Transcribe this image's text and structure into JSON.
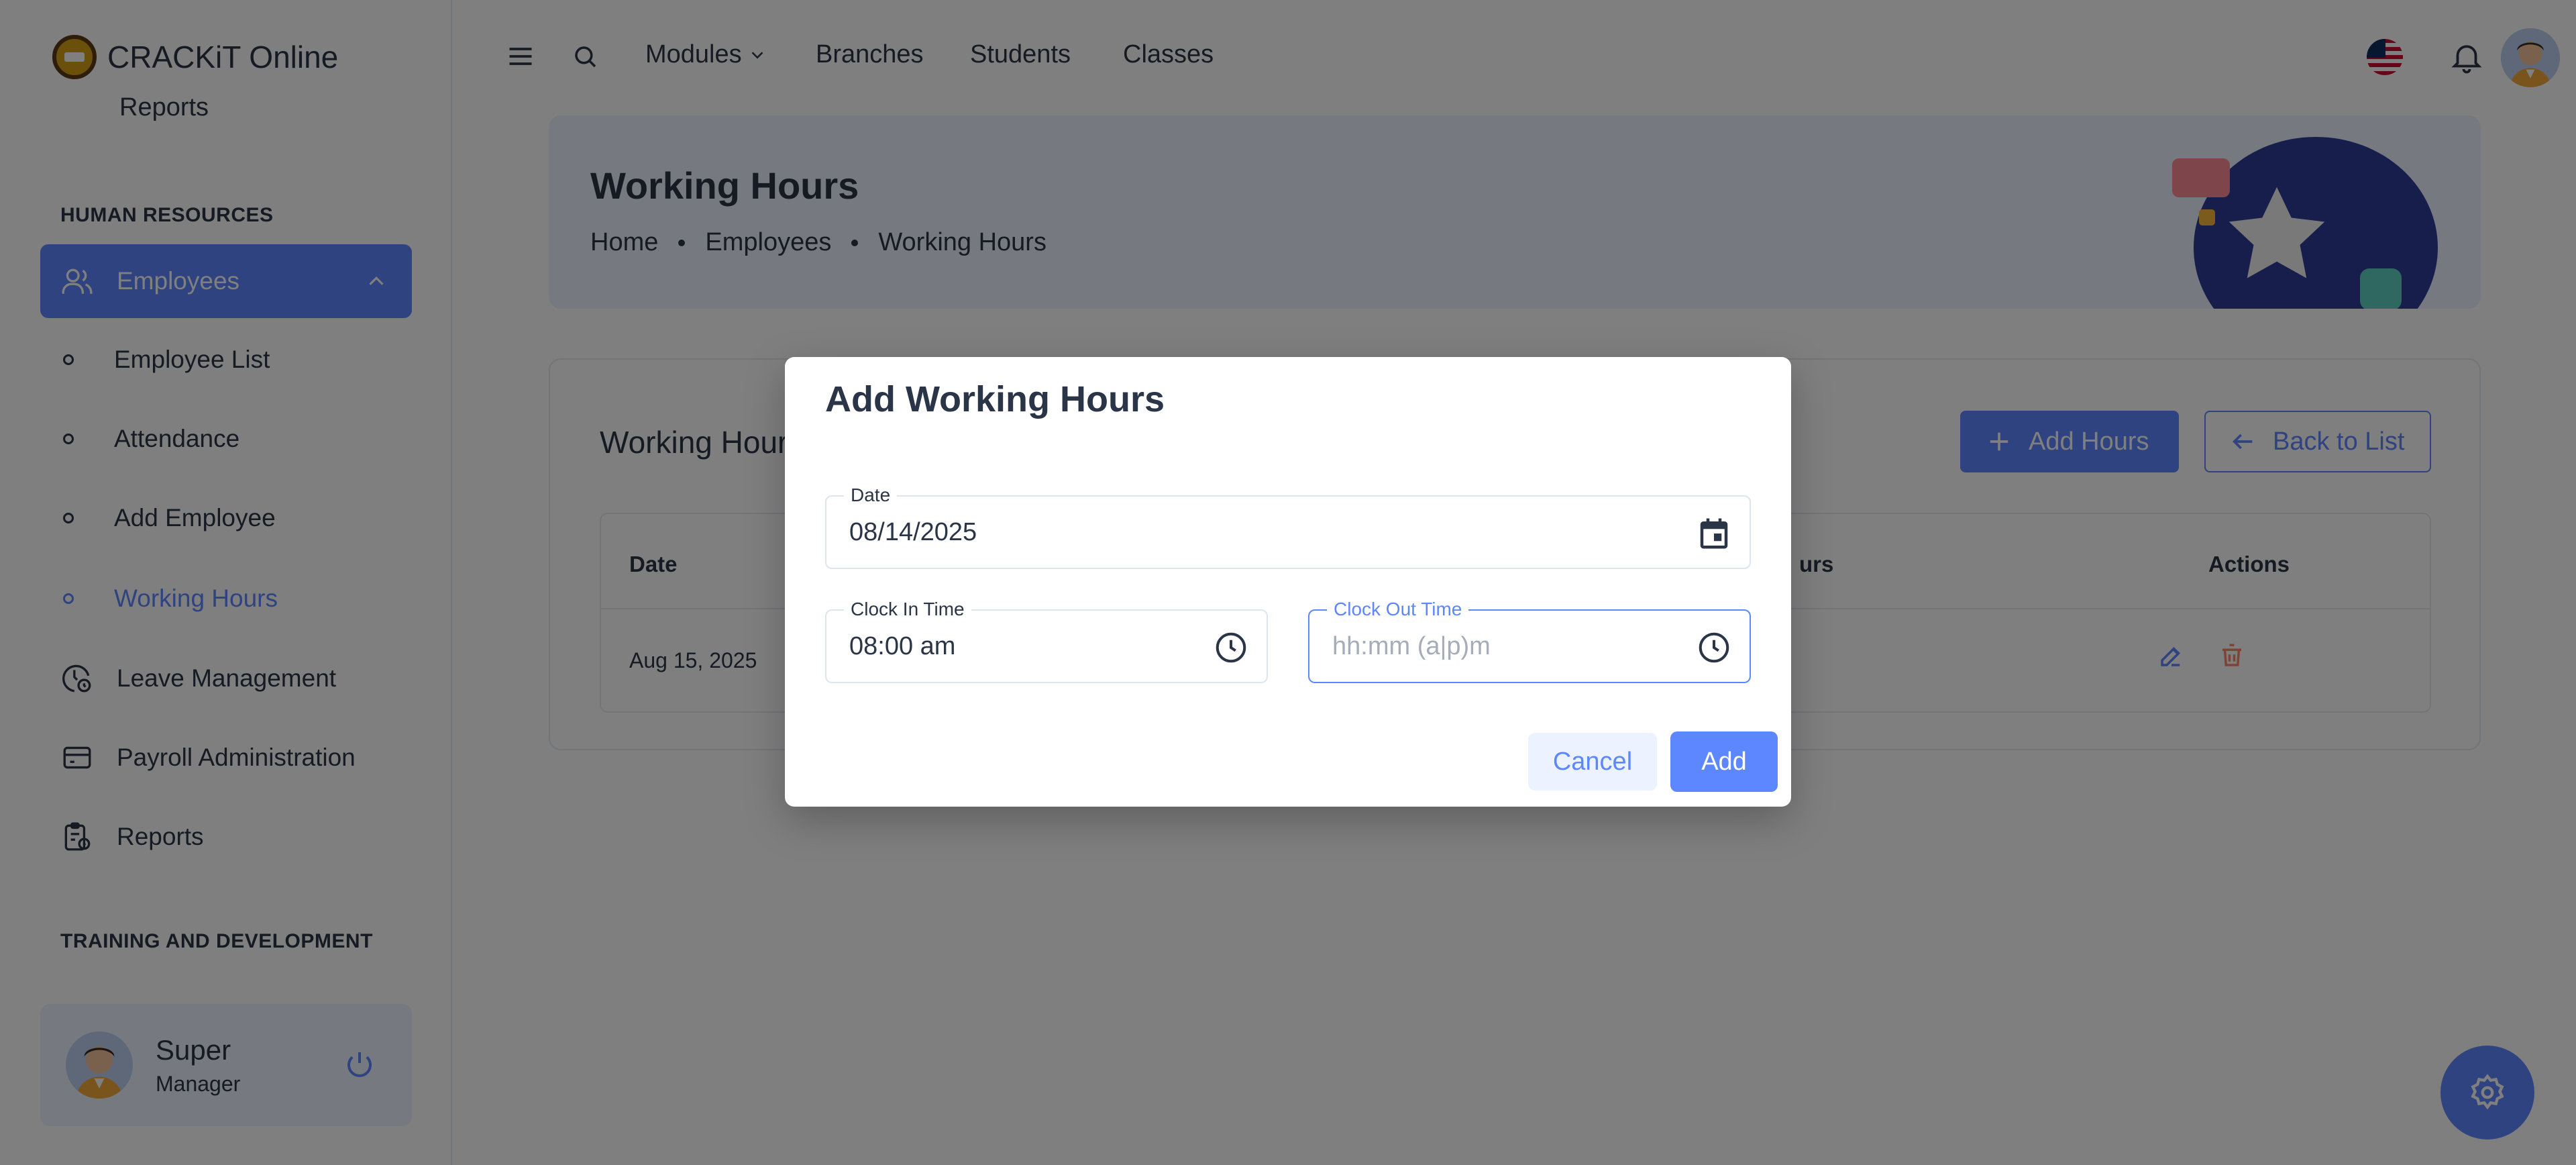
{
  "app": {
    "brand": "CRACKiT Online"
  },
  "topnav": {
    "items": [
      "Modules",
      "Branches",
      "Students",
      "Classes"
    ]
  },
  "sidebar": {
    "partial_item": "Reports",
    "section_hr": "HUMAN RESOURCES",
    "employees": "Employees",
    "sub_items": [
      "Employee List",
      "Attendance",
      "Add Employee",
      "Working Hours"
    ],
    "leave": "Leave Management",
    "payroll": "Payroll Administration",
    "reports": "Reports",
    "section_training": "TRAINING AND DEVELOPMENT",
    "user": {
      "name": "Super",
      "role": "Manager"
    }
  },
  "page": {
    "title": "Working Hours",
    "breadcrumb": [
      "Home",
      "Employees",
      "Working Hours"
    ]
  },
  "card": {
    "title": "Working Hours",
    "add_button": "Add Hours",
    "back_button": "Back to List",
    "columns": {
      "date": "Date",
      "hours_partial": "urs",
      "actions": "Actions"
    },
    "rows": [
      {
        "date": "Aug 15, 2025"
      }
    ]
  },
  "modal": {
    "title": "Add Working Hours",
    "date": {
      "label": "Date",
      "value": "08/14/2025"
    },
    "clock_in": {
      "label": "Clock In Time",
      "value": "08:00 am"
    },
    "clock_out": {
      "label": "Clock Out Time",
      "placeholder": "hh:mm (a|p)m"
    },
    "cancel": "Cancel",
    "add": "Add"
  },
  "colors": {
    "primary": "#5d87ff",
    "text": "#2a3547",
    "light_primary": "#ecf2ff",
    "danger": "#fa896b"
  }
}
